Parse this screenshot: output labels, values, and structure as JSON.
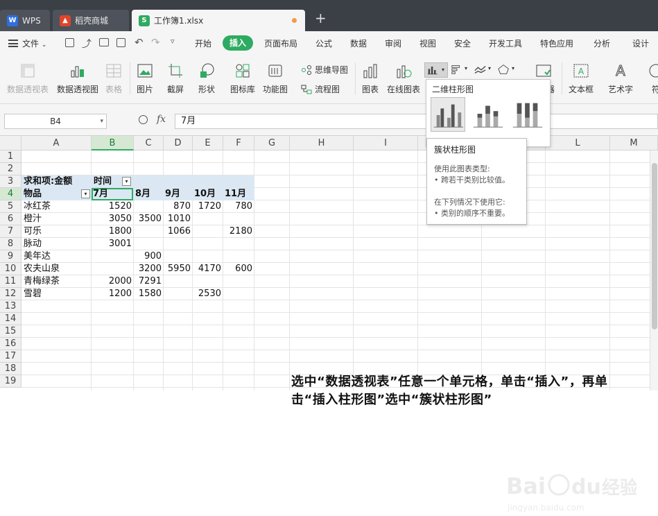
{
  "titlebar": {
    "tabs": [
      {
        "label": "WPS"
      },
      {
        "label": "稻壳商城"
      },
      {
        "label": "工作簿1.xlsx"
      }
    ],
    "new_tab": "+"
  },
  "menubar": {
    "file": "文件",
    "items": [
      "开始",
      "插入",
      "页面布局",
      "公式",
      "数据",
      "审阅",
      "视图",
      "安全",
      "开发工具",
      "特色应用",
      "分析",
      "设计"
    ],
    "active": "插入"
  },
  "ribbon": {
    "pivot_table": "数据透视表",
    "pivot_chart": "数据透视图",
    "table": "表格",
    "picture": "图片",
    "screenshot": "截屏",
    "shape": "形状",
    "icon_lib": "图标库",
    "func_chart": "功能图",
    "mindmap": "思维导图",
    "flowchart": "流程图",
    "chart": "图表",
    "online_chart": "在线图表",
    "textbox": "文本框",
    "wordart": "艺术字",
    "symbol": "符",
    "partial": "器"
  },
  "formulabar": {
    "cell_ref": "B4",
    "fx": "fx",
    "value": "7月"
  },
  "grid": {
    "columns": [
      "A",
      "B",
      "C",
      "D",
      "E",
      "F",
      "G",
      "H",
      "I",
      "J",
      "K",
      "L",
      "M"
    ],
    "rows": [
      "1",
      "2",
      "3",
      "4",
      "5",
      "6",
      "7",
      "8",
      "9",
      "10",
      "11",
      "12",
      "13",
      "14",
      "15",
      "16",
      "17",
      "18",
      "19"
    ],
    "pivot": {
      "sum_label": "求和项:金额",
      "time_label": "时间",
      "item_label": "物品",
      "months": [
        "7月",
        "8月",
        "9月",
        "10月",
        "11月"
      ],
      "rows": [
        {
          "name": "冰红茶",
          "v": [
            "1520",
            "",
            "870",
            "1720",
            "780"
          ]
        },
        {
          "name": "橙汁",
          "v": [
            "3050",
            "3500",
            "1010",
            "",
            ""
          ]
        },
        {
          "name": "可乐",
          "v": [
            "1800",
            "",
            "1066",
            "",
            "2180"
          ]
        },
        {
          "name": "脉动",
          "v": [
            "3001",
            "",
            "",
            "",
            ""
          ]
        },
        {
          "name": "美年达",
          "v": [
            "",
            "900",
            "",
            "",
            ""
          ]
        },
        {
          "name": "农夫山泉",
          "v": [
            "",
            "3200",
            "5950",
            "4170",
            "600"
          ]
        },
        {
          "name": "青梅绿茶",
          "v": [
            "2000",
            "7291",
            "",
            "",
            ""
          ]
        },
        {
          "name": "雪碧",
          "v": [
            "1200",
            "1580",
            "",
            "2530",
            ""
          ]
        }
      ]
    }
  },
  "instruction": "选中“数据透视表”任意一个单元格，单击“插入”，再单击“插入柱形图”选中“簇状柱形图”",
  "chart_panel": {
    "title": "二维柱形图",
    "tooltip_title": "簇状柱形图",
    "tooltip_lines": [
      "使用此图表类型:",
      "• 跨若干类别比较值。",
      "",
      "在下列情况下使用它:",
      "• 类别的顺序不重要。"
    ]
  },
  "watermark": {
    "text": "Baidu经验",
    "sub": "jingyan.baidu.com"
  },
  "colors": {
    "accent": "#2eab62",
    "titlebar": "#3b3f46",
    "pivot_header": "#dbe8f4"
  }
}
